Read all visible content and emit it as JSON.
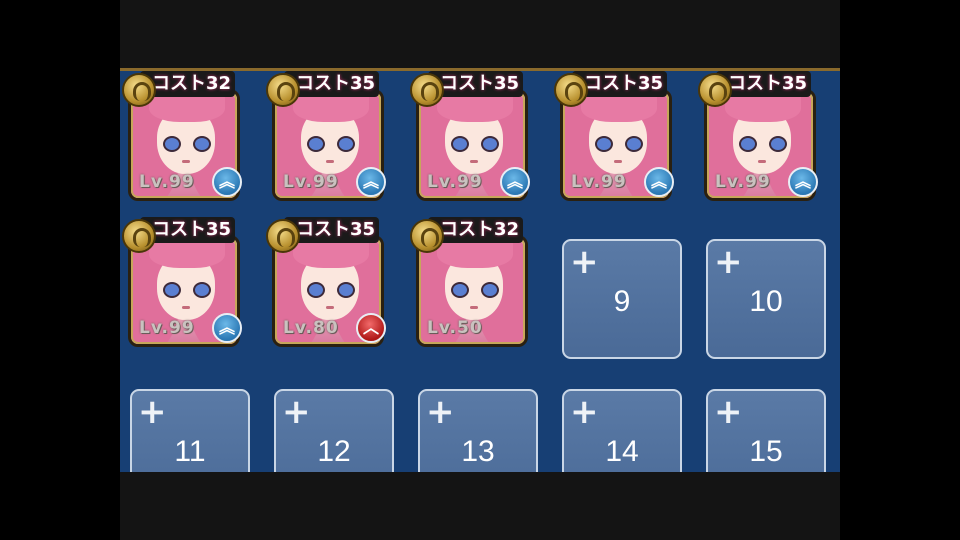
{
  "team": {
    "characters": [
      {
        "cost": "コスト32",
        "level": "Lv.99",
        "badge": "up",
        "badge_icon": "double-chevron-up-icon"
      },
      {
        "cost": "コスト35",
        "level": "Lv.99",
        "badge": "up",
        "badge_icon": "double-chevron-up-icon"
      },
      {
        "cost": "コスト35",
        "level": "Lv.99",
        "badge": "up",
        "badge_icon": "double-chevron-up-icon"
      },
      {
        "cost": "コスト35",
        "level": "Lv.99",
        "badge": "up",
        "badge_icon": "double-chevron-up-icon"
      },
      {
        "cost": "コスト35",
        "level": "Lv.99",
        "badge": "up",
        "badge_icon": "double-chevron-up-icon"
      },
      {
        "cost": "コスト35",
        "level": "Lv.99",
        "badge": "up",
        "badge_icon": "double-chevron-up-icon"
      },
      {
        "cost": "コスト35",
        "level": "Lv.80",
        "badge": "alert",
        "badge_icon": "chevron-up-icon"
      },
      {
        "cost": "コスト32",
        "level": "Lv.50",
        "badge": "",
        "badge_icon": ""
      }
    ],
    "empty_slots": [
      "9",
      "10",
      "11",
      "12",
      "13",
      "14",
      "15"
    ]
  },
  "colors": {
    "panel_bg": "#173f74",
    "empty_slot_bg": "#4e6e9b",
    "up_badge": "#2b78b4",
    "alert_badge": "#b01818"
  }
}
